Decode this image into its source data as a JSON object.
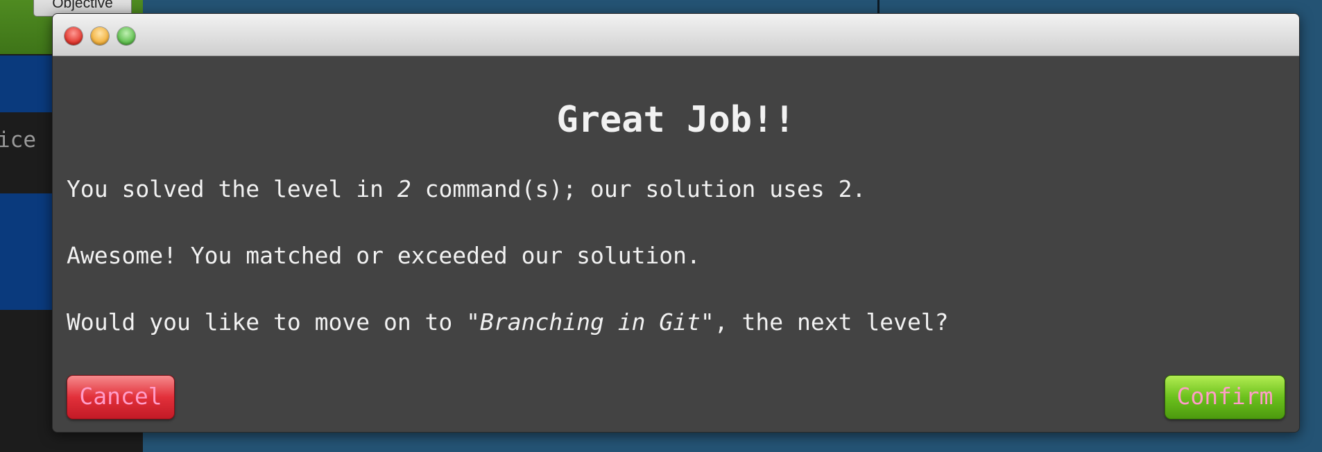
{
  "background": {
    "objective_button": "Objective",
    "peek_text": "ice"
  },
  "dialog": {
    "title": "Great Job!!",
    "line1": {
      "before": "You solved the level in ",
      "count": "2",
      "after": " command(s); our solution uses 2."
    },
    "line2": "Awesome! You matched or exceeded our solution.",
    "line3": {
      "before": "Would you like to move on to ",
      "level_name": "\"Branching in Git\"",
      "after": ", the next level?"
    },
    "cancel_label": "Cancel",
    "confirm_label": "Confirm"
  },
  "colors": {
    "modal_bg": "#434343",
    "cancel_bg": "#e2303a",
    "confirm_bg": "#6cc11d",
    "button_text": "#ff9cc8",
    "desktop_bg": "#245374"
  }
}
